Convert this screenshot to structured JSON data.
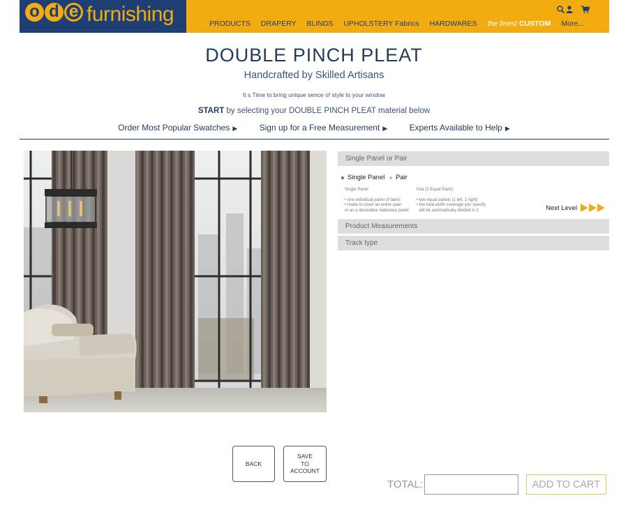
{
  "brand": {
    "logo_letters": [
      "o",
      "d",
      "e"
    ],
    "logo_text": "furnishing",
    "primary_color": "#1d3f74",
    "accent_color": "#f2ac10"
  },
  "nav": {
    "items": [
      "PRODUCTS",
      "DRAPERY",
      "BLINDS",
      "UPHOLSTERY Fabrics",
      "HARDWARES"
    ],
    "custom_finest": "the finest",
    "custom_label": "CUSTOM",
    "more": "More..."
  },
  "header_icons": [
    "search-icon",
    "user-icon",
    "cart-icon"
  ],
  "hero": {
    "title": "DOUBLE PINCH PLEAT",
    "subtitle": "Handcrafted by Skilled Artisans",
    "tagline": "It s Time to bring unique sence of style to your window",
    "start_bold": "START",
    "start_rest": "by selecting your DOUBLE PINCH PLEAT material below"
  },
  "links": [
    {
      "label": "Order Most Popular Swatches",
      "arrow": "▶"
    },
    {
      "label": "Sign up for a Free Measurement",
      "arrow": "▶"
    },
    {
      "label": "Experts Available to Help",
      "arrow": "▶"
    }
  ],
  "options": {
    "section1": "Single Panel or Pair",
    "radio_single": "Single Panel",
    "radio_pair": "Pair",
    "selected": "single",
    "single_header": "Single Panel",
    "single_lines": [
      "• one individual panel of fabric",
      "• made to cover an entire span",
      "or as a decorative stationary panel"
    ],
    "pair_header": "Pair (2 Equal Parts)",
    "pair_lines": [
      "• two equal panels (1 left, 1 right)",
      "• the total width coverage you specify",
      "  will be automatically divided in 2"
    ],
    "next_level": "Next Level",
    "section2": "Product Measurements",
    "section3": "Track type"
  },
  "actions": {
    "back": "BACK",
    "save_line1": "SAVE",
    "save_line2": "TO",
    "save_line3": "ACCOUNT",
    "total_label": "TOTAL:",
    "total_value": "",
    "add_to_cart": "ADD TO CART"
  }
}
